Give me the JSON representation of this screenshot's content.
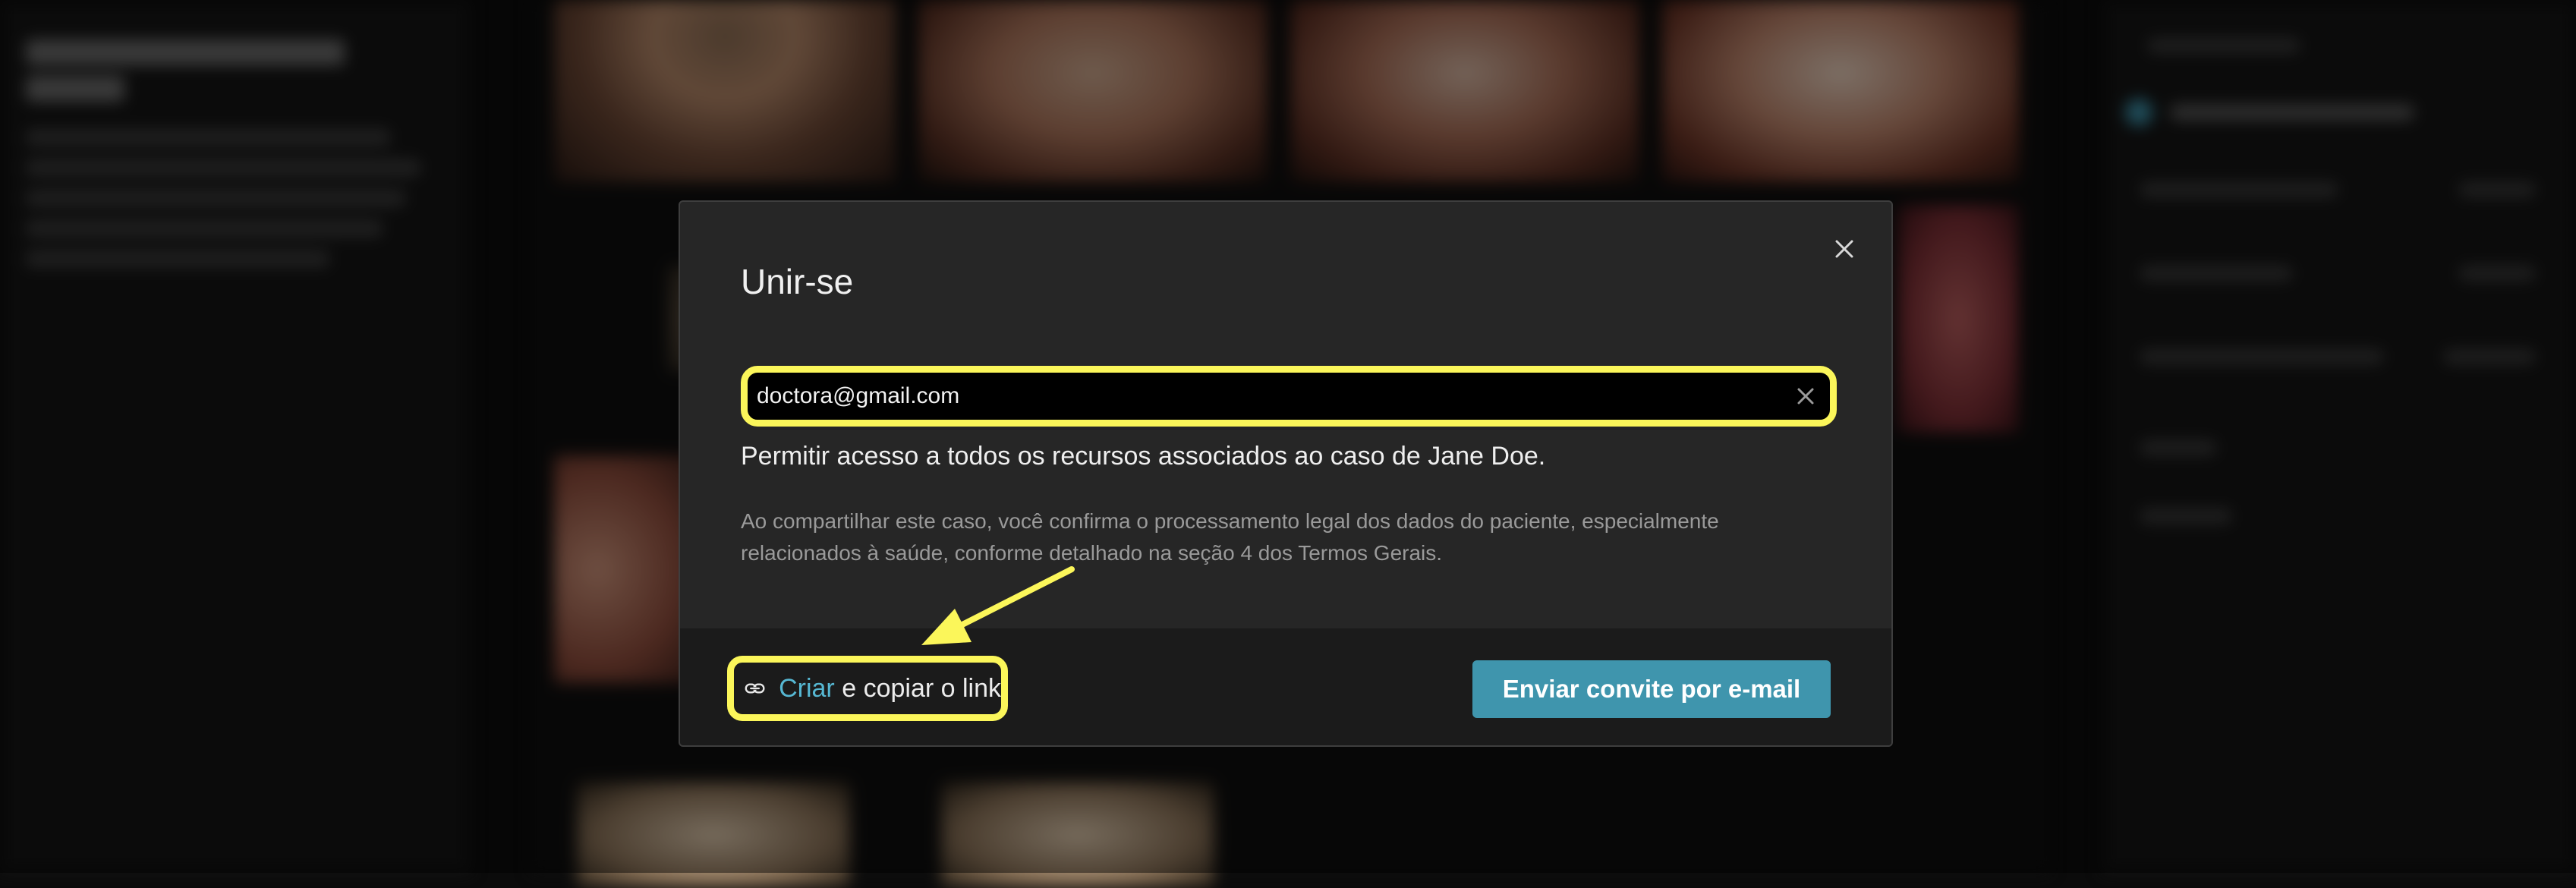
{
  "modal": {
    "title": "Unir-se",
    "close_icon": "close-icon",
    "email": {
      "value": "doctora@gmail.com",
      "clear_icon": "clear-icon"
    },
    "access_text": "Permitir acesso a todos os recursos associados ao caso de Jane Doe.",
    "legal_text": "Ao compartilhar este caso, você confirma o processamento legal dos dados do paciente, especialmente relacionados à saúde, conforme detalhado na seção 4 dos Termos Gerais.",
    "footer": {
      "link_icon": "link-icon",
      "create_label": "Criar",
      "copy_label": " e copiar o link",
      "send_button": "Enviar convite por e-mail"
    }
  },
  "colors": {
    "highlight": "#fbf65a",
    "accent": "#3f95ad",
    "link_accent": "#56b7d2"
  }
}
